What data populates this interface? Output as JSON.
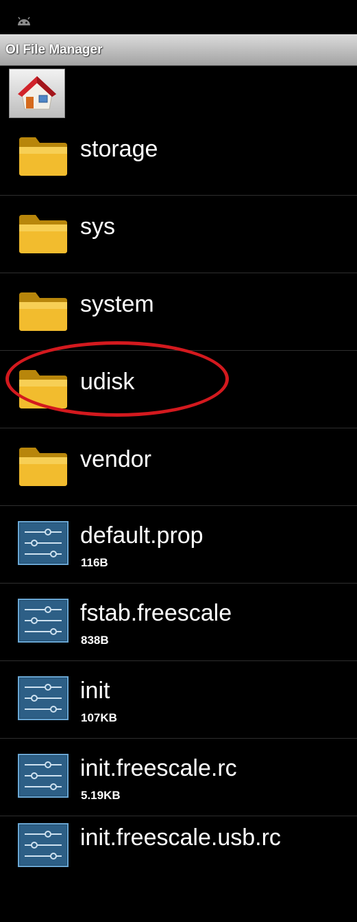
{
  "app": {
    "title": "OI File Manager",
    "status_icon": "android-icon"
  },
  "toolbar": {
    "home_icon": "home-icon"
  },
  "annotation": {
    "highlight_color": "#d3191e",
    "highlighted_item": "udisk"
  },
  "files": [
    {
      "name": "storage",
      "type": "folder",
      "icon": "folder-icon"
    },
    {
      "name": "sys",
      "type": "folder",
      "icon": "folder-icon"
    },
    {
      "name": "system",
      "type": "folder",
      "icon": "folder-icon"
    },
    {
      "name": "udisk",
      "type": "folder",
      "icon": "folder-icon"
    },
    {
      "name": "vendor",
      "type": "folder",
      "icon": "folder-icon"
    },
    {
      "name": "default.prop",
      "type": "file",
      "size": "116B",
      "icon": "settings-file-icon"
    },
    {
      "name": "fstab.freescale",
      "type": "file",
      "size": "838B",
      "icon": "settings-file-icon"
    },
    {
      "name": "init",
      "type": "file",
      "size": "107KB",
      "icon": "settings-file-icon"
    },
    {
      "name": "init.freescale.rc",
      "type": "file",
      "size": "5.19KB",
      "icon": "settings-file-icon"
    },
    {
      "name": "init.freescale.usb.rc",
      "type": "file",
      "icon": "settings-file-icon"
    }
  ]
}
